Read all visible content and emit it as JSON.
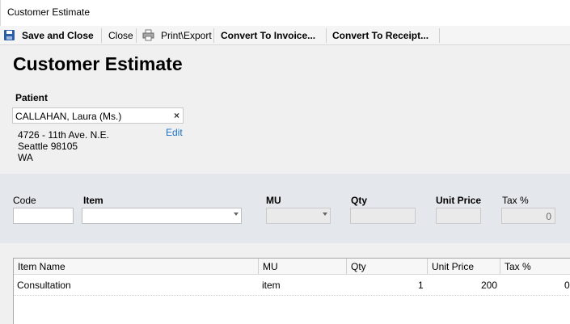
{
  "window": {
    "title": "Customer Estimate"
  },
  "toolbar": {
    "save_close": "Save and Close",
    "close": "Close",
    "print_export": "Print\\Export",
    "convert_invoice": "Convert To Invoice...",
    "convert_receipt": "Convert To Receipt..."
  },
  "page": {
    "heading": "Customer Estimate"
  },
  "patient": {
    "label": "Patient",
    "value": "CALLAHAN, Laura (Ms.)",
    "clear": "×",
    "address": [
      "4726 - 11th Ave. N.E.",
      "Seattle 98105",
      "WA"
    ],
    "edit": "Edit"
  },
  "entry": {
    "code_label": "Code",
    "item_label": "Item",
    "mu_label": "MU",
    "qty_label": "Qty",
    "unit_price_label": "Unit Price",
    "tax_label": "Tax %",
    "tax_value": "0"
  },
  "grid": {
    "columns": [
      "Item Name",
      "MU",
      "Qty",
      "Unit Price",
      "Tax %"
    ],
    "rows": [
      {
        "item_name": "Consultation",
        "mu": "item",
        "qty": "1",
        "unit_price": "200",
        "tax": "0"
      }
    ]
  }
}
